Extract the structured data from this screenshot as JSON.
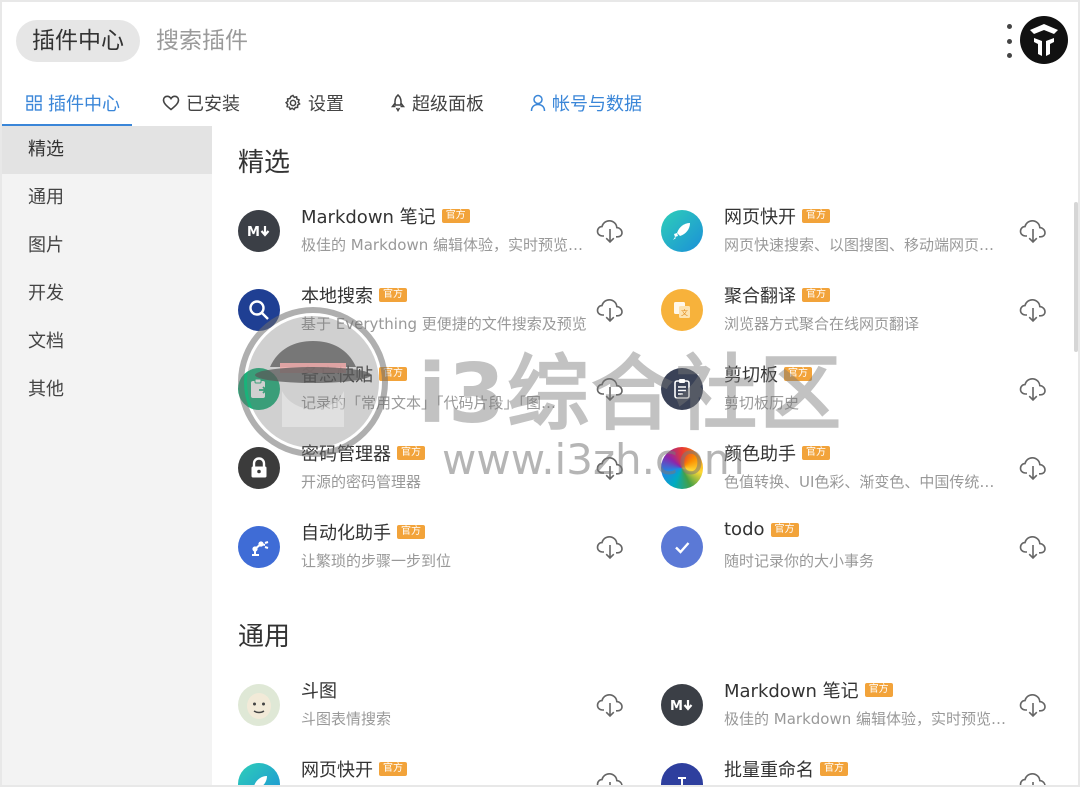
{
  "header": {
    "title": "插件中心",
    "search_placeholder": "搜索插件"
  },
  "nav": {
    "tabs": [
      {
        "label": "插件中心",
        "icon": "grid-icon"
      },
      {
        "label": "已安装",
        "icon": "heart-icon"
      },
      {
        "label": "设置",
        "icon": "gear-icon"
      },
      {
        "label": "超级面板",
        "icon": "rocket-icon"
      },
      {
        "label": "帐号与数据",
        "icon": "user-icon"
      }
    ]
  },
  "sidebar": {
    "items": [
      {
        "label": "精选"
      },
      {
        "label": "通用"
      },
      {
        "label": "图片"
      },
      {
        "label": "开发"
      },
      {
        "label": "文档"
      },
      {
        "label": "其他"
      }
    ]
  },
  "official_badge": "官方",
  "sections": [
    {
      "title": "精选",
      "plugins": [
        {
          "name": "Markdown 笔记",
          "official": true,
          "desc": "极佳的 Markdown 编辑体验，实时预览…",
          "icon": "markdown-icon"
        },
        {
          "name": "网页快开",
          "official": true,
          "desc": "网页快速搜索、以图搜图、移动端网页…",
          "icon": "rocket-icon"
        },
        {
          "name": "本地搜索",
          "official": true,
          "desc": "基于 Everything 更便捷的文件搜索及预览",
          "icon": "magnifier-icon"
        },
        {
          "name": "聚合翻译",
          "official": true,
          "desc": "浏览器方式聚合在线网页翻译",
          "icon": "translate-icon"
        },
        {
          "name": "备忘快贴",
          "official": true,
          "desc": "记录的「常用文本」「代码片段」「图…",
          "icon": "clipboard-icon"
        },
        {
          "name": "剪切板",
          "official": true,
          "desc": "剪切板历史",
          "icon": "clipboard-history-icon"
        },
        {
          "name": "密码管理器",
          "official": true,
          "desc": "开源的密码管理器",
          "icon": "lock-icon"
        },
        {
          "name": "颜色助手",
          "official": true,
          "desc": "色值转换、UI色彩、渐变色、中国传统…",
          "icon": "color-wheel-icon"
        },
        {
          "name": "自动化助手",
          "official": true,
          "desc": "让繁琐的步骤一步到位",
          "icon": "robot-arm-icon"
        },
        {
          "name": "todo",
          "official": true,
          "desc": "随时记录你的大小事务",
          "icon": "check-icon"
        }
      ]
    },
    {
      "title": "通用",
      "plugins": [
        {
          "name": "斗图",
          "official": false,
          "desc": "斗图表情搜索",
          "icon": "meme-face-icon"
        },
        {
          "name": "Markdown 笔记",
          "official": true,
          "desc": "极佳的 Markdown 编辑体验，实时预览…",
          "icon": "markdown-icon"
        },
        {
          "name": "网页快开",
          "official": true,
          "desc": "",
          "icon": "rocket-icon"
        },
        {
          "name": "批量重命名",
          "official": true,
          "desc": "",
          "icon": "rename-icon"
        }
      ]
    }
  ],
  "watermark": {
    "text": "i3综合社区",
    "url": "www.i3zh.com"
  },
  "colors": {
    "accent": "#3a86d8",
    "badge": "#f2a33a",
    "sidebar_bg": "#f3f3f3",
    "sidebar_active": "#e3e3e3"
  }
}
